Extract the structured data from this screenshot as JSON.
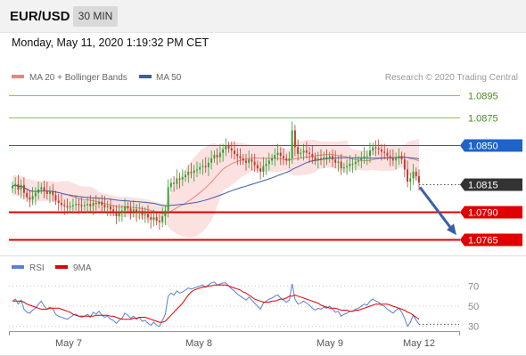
{
  "header": {
    "symbol": "EUR/USD",
    "timeframe": "30 MIN"
  },
  "datetime": "Monday, May 11, 2020 1:19:32 PM CET",
  "legend": {
    "ma20": "MA 20 + Bollinger Bands",
    "ma50": "MA 50",
    "copyright": "Research © 2020 Trading Central",
    "rsi": "RSI",
    "ma9": "9MA"
  },
  "colors": {
    "bull": "#2ca02c",
    "bear": "#c0392b",
    "bollinger_fill": "#fcdede",
    "ma20": "#f08080",
    "ma50": "#3a5fa8",
    "resistance": "#8cc152",
    "pivot": "#1e64c8",
    "support": "#e00000",
    "last": "#333333",
    "rsi": "#5b7fd6",
    "ma9": "#e00000"
  },
  "chart_data": [
    {
      "type": "candlestick",
      "x_labels": [
        "May 7",
        "May 8",
        "May 9",
        "May 12"
      ],
      "ylim": [
        1.0758,
        1.0905
      ],
      "grid": false,
      "legend_position": "top-left",
      "levels": [
        {
          "label": "1.0895",
          "value": 1.0895,
          "kind": "resistance"
        },
        {
          "label": "1.0875",
          "value": 1.0875,
          "kind": "resistance"
        },
        {
          "label": "1.0850",
          "value": 1.085,
          "kind": "pivot"
        },
        {
          "label": "1.0815",
          "value": 1.0815,
          "kind": "last"
        },
        {
          "label": "1.0790",
          "value": 1.079,
          "kind": "support"
        },
        {
          "label": "1.0765",
          "value": 1.0765,
          "kind": "support"
        }
      ],
      "forecast_arrow": {
        "from": 1.0812,
        "to": 1.0769
      },
      "close": [
        1.0813,
        1.0815,
        1.081,
        1.0814,
        1.0807,
        1.0803,
        1.0801,
        1.0804,
        1.0807,
        1.081,
        1.0812,
        1.0809,
        1.0806,
        1.0808,
        1.0805,
        1.08,
        1.0798,
        1.0796,
        1.0795,
        1.0794,
        1.0795,
        1.0796,
        1.0797,
        1.0796,
        1.0795,
        1.0796,
        1.0797,
        1.0795,
        1.0798,
        1.0797,
        1.0799,
        1.0796,
        1.0794,
        1.0795,
        1.0792,
        1.079,
        1.0786,
        1.0789,
        1.0791,
        1.0795,
        1.0793,
        1.079,
        1.0792,
        1.0789,
        1.0791,
        1.0787,
        1.0788,
        1.0785,
        1.0783,
        1.0785,
        1.0782,
        1.0781,
        1.0786,
        1.0791,
        1.0812,
        1.0816,
        1.0815,
        1.082,
        1.0819,
        1.0821,
        1.0823,
        1.0826,
        1.0825,
        1.0827,
        1.0828,
        1.083,
        1.0831,
        1.083,
        1.0834,
        1.0838,
        1.0841,
        1.0839,
        1.0843,
        1.0846,
        1.0849,
        1.0847,
        1.0845,
        1.0842,
        1.084,
        1.0838,
        1.0836,
        1.0834,
        1.0837,
        1.0835,
        1.0832,
        1.0829,
        1.0826,
        1.0831,
        1.0833,
        1.0836,
        1.0838,
        1.0841,
        1.0843,
        1.084,
        1.0838,
        1.0836,
        1.0838,
        1.0863,
        1.0848,
        1.0842,
        1.0843,
        1.0845,
        1.0843,
        1.0842,
        1.0839,
        1.0836,
        1.0838,
        1.0837,
        1.0839,
        1.0838,
        1.084,
        1.0837,
        1.0834,
        1.0835,
        1.0829,
        1.083,
        1.0831,
        1.0833,
        1.0833,
        1.0835,
        1.0836,
        1.0838,
        1.084,
        1.084,
        1.0845,
        1.0848,
        1.0847,
        1.0846,
        1.0844,
        1.0843,
        1.084,
        1.0838,
        1.0836,
        1.0838,
        1.084,
        1.0837,
        1.0828,
        1.0817,
        1.082,
        1.0826,
        1.0822,
        1.0816
      ]
    },
    {
      "type": "line",
      "title": "RSI",
      "x_labels": [
        "May 7",
        "May 8",
        "May 9",
        "May 12"
      ],
      "ylim": [
        20,
        80
      ],
      "y_ticks": [
        70,
        50,
        30
      ],
      "series": [
        {
          "name": "RSI",
          "values": [
            55,
            57,
            52,
            56,
            47,
            44,
            43,
            46,
            48,
            52,
            55,
            50,
            47,
            49,
            47,
            42,
            40,
            39,
            38,
            37,
            39,
            41,
            42,
            40,
            39,
            40,
            42,
            39,
            44,
            42,
            45,
            41,
            39,
            40,
            37,
            36,
            33,
            36,
            38,
            43,
            41,
            38,
            40,
            37,
            39,
            35,
            36,
            33,
            31,
            34,
            31,
            30,
            36,
            42,
            60,
            63,
            61,
            65,
            63,
            64,
            66,
            68,
            67,
            68,
            69,
            70,
            71,
            69,
            71,
            73,
            74,
            71,
            72,
            73,
            73,
            70,
            67,
            65,
            62,
            60,
            58,
            56,
            59,
            56,
            53,
            50,
            47,
            53,
            55,
            57,
            58,
            60,
            61,
            58,
            56,
            54,
            56,
            72,
            57,
            52,
            53,
            55,
            53,
            51,
            48,
            46,
            48,
            47,
            49,
            48,
            50,
            47,
            44,
            45,
            40,
            42,
            43,
            45,
            45,
            47,
            48,
            50,
            52,
            51,
            55,
            57,
            55,
            54,
            51,
            50,
            47,
            45,
            43,
            46,
            48,
            44,
            38,
            30,
            34,
            41,
            36,
            32
          ]
        },
        {
          "name": "9MA",
          "values": [
            55,
            55,
            55,
            55,
            54,
            52,
            51,
            50,
            49,
            48,
            47,
            47,
            47,
            48,
            48,
            48,
            48,
            47,
            46,
            45,
            44,
            42,
            41,
            40,
            40,
            40,
            40,
            40,
            40,
            41,
            41,
            41,
            41,
            41,
            40,
            40,
            39,
            38,
            37,
            37,
            37,
            37,
            38,
            38,
            39,
            39,
            39,
            38,
            37,
            36,
            35,
            34,
            34,
            35,
            38,
            41,
            44,
            47,
            50,
            53,
            57,
            61,
            64,
            66,
            67,
            68,
            69,
            69,
            70,
            70,
            71,
            71,
            71,
            71,
            71,
            70,
            69,
            68,
            67,
            66,
            64,
            63,
            61,
            59,
            57,
            56,
            55,
            54,
            54,
            54,
            55,
            55,
            56,
            57,
            57,
            58,
            60,
            60,
            61,
            60,
            59,
            58,
            57,
            56,
            55,
            54,
            53,
            51,
            50,
            49,
            48,
            48,
            48,
            47,
            46,
            46,
            46,
            45,
            45,
            46,
            46,
            47,
            48,
            49,
            50,
            51,
            52,
            52,
            52,
            52,
            52,
            51,
            50,
            49,
            48,
            47,
            46,
            44,
            43,
            41,
            39,
            37
          ]
        }
      ]
    }
  ]
}
